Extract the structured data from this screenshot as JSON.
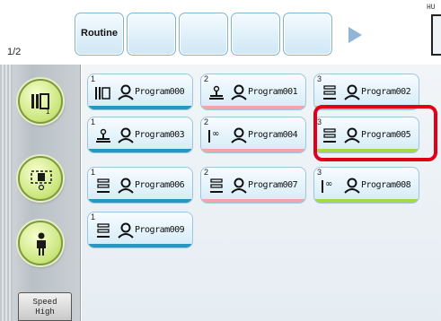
{
  "header": {
    "page_indicator": "1/2",
    "tabs": [
      {
        "label": "Routine"
      },
      {
        "label": ""
      },
      {
        "label": ""
      },
      {
        "label": ""
      },
      {
        "label": ""
      }
    ],
    "hu_label": "HU"
  },
  "left_panel": {
    "speed_label_line1": "Speed",
    "speed_label_line2": "High",
    "mode_buttons": [
      {
        "icon": "image-layers-icon",
        "badge": "1"
      },
      {
        "icon": "grid-focus-icon"
      },
      {
        "icon": "person-icon"
      }
    ]
  },
  "programs": [
    {
      "num": "1",
      "name": "Program000",
      "kind": "layers",
      "strip": "#2a96c0"
    },
    {
      "num": "2",
      "name": "Program001",
      "kind": "scale",
      "strip": "#f2a5a5"
    },
    {
      "num": "3",
      "name": "Program002",
      "kind": "stack",
      "strip": "#a6d84a"
    },
    {
      "num": "1",
      "name": "Program003",
      "kind": "scale",
      "strip": "#2a96c0"
    },
    {
      "num": "2",
      "name": "Program004",
      "kind": "infinity",
      "strip": "#f2a5a5"
    },
    {
      "num": "3",
      "name": "Program005",
      "kind": "stack",
      "strip": "#a6d84a"
    },
    {
      "num": "1",
      "name": "Program006",
      "kind": "stack",
      "strip": "#2a96c0"
    },
    {
      "num": "2",
      "name": "Program007",
      "kind": "stack",
      "strip": "#f2a5a5"
    },
    {
      "num": "3",
      "name": "Program008",
      "kind": "infinity",
      "strip": "#a6d84a"
    },
    {
      "num": "1",
      "name": "Program009",
      "kind": "stack",
      "strip": "#2a96c0"
    }
  ],
  "selected_program": "Program005",
  "colors": {
    "selection": "#e0001a",
    "strip_1": "#2a96c0",
    "strip_2": "#f2a5a5",
    "strip_3": "#a6d84a"
  }
}
